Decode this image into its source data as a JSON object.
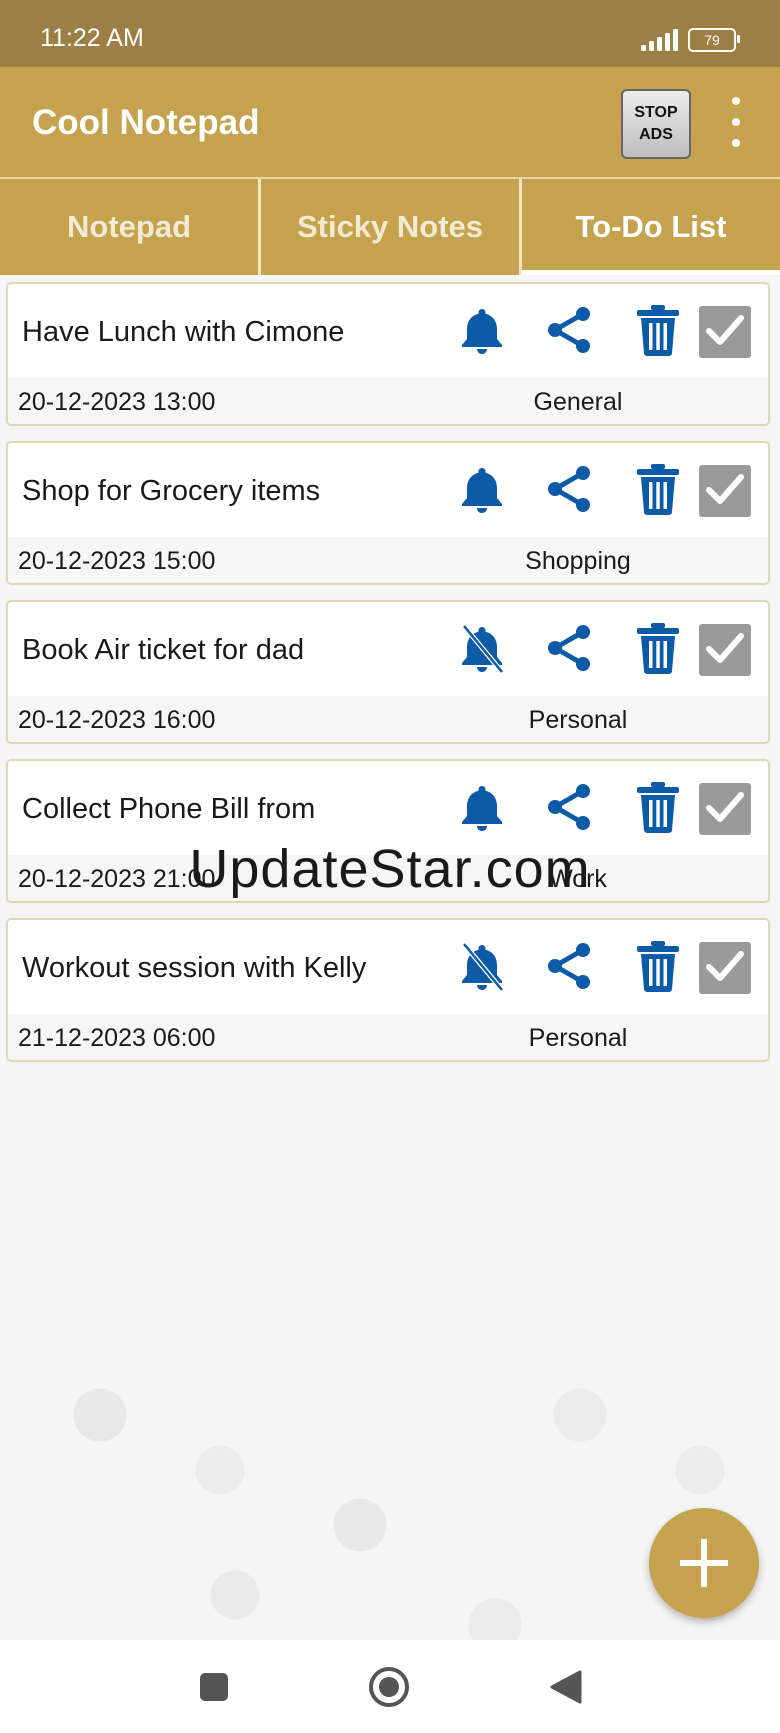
{
  "status_bar": {
    "time": "11:22 AM",
    "battery": "79"
  },
  "app_bar": {
    "title": "Cool Notepad",
    "stop_ads_line1": "STOP",
    "stop_ads_line2": "ADS"
  },
  "tabs": [
    {
      "label": "Notepad",
      "active": false
    },
    {
      "label": "Sticky Notes",
      "active": false
    },
    {
      "label": "To-Do List",
      "active": true
    }
  ],
  "todos": [
    {
      "title": "Have Lunch with Cimone",
      "datetime": "20-12-2023 13:00",
      "category": "General",
      "reminder": "bell-icon"
    },
    {
      "title": "Shop for Grocery items",
      "datetime": "20-12-2023 15:00",
      "category": "Shopping",
      "reminder": "bell-icon"
    },
    {
      "title": "Book Air ticket for dad",
      "datetime": "20-12-2023 16:00",
      "category": "Personal",
      "reminder": "bell-off-icon"
    },
    {
      "title": "Collect Phone Bill from",
      "datetime": "20-12-2023 21:00",
      "category": "Work",
      "reminder": "bell-icon"
    },
    {
      "title": "Workout session with Kelly",
      "datetime": "21-12-2023 06:00",
      "category": "Personal",
      "reminder": "bell-off-icon"
    }
  ],
  "watermark": "UpdateStar.com",
  "colors": {
    "accent": "#c4a24e",
    "status_bar": "#9b7f45",
    "icon_blue": "#0d5aa7",
    "check_bg": "#9a9a9a"
  }
}
